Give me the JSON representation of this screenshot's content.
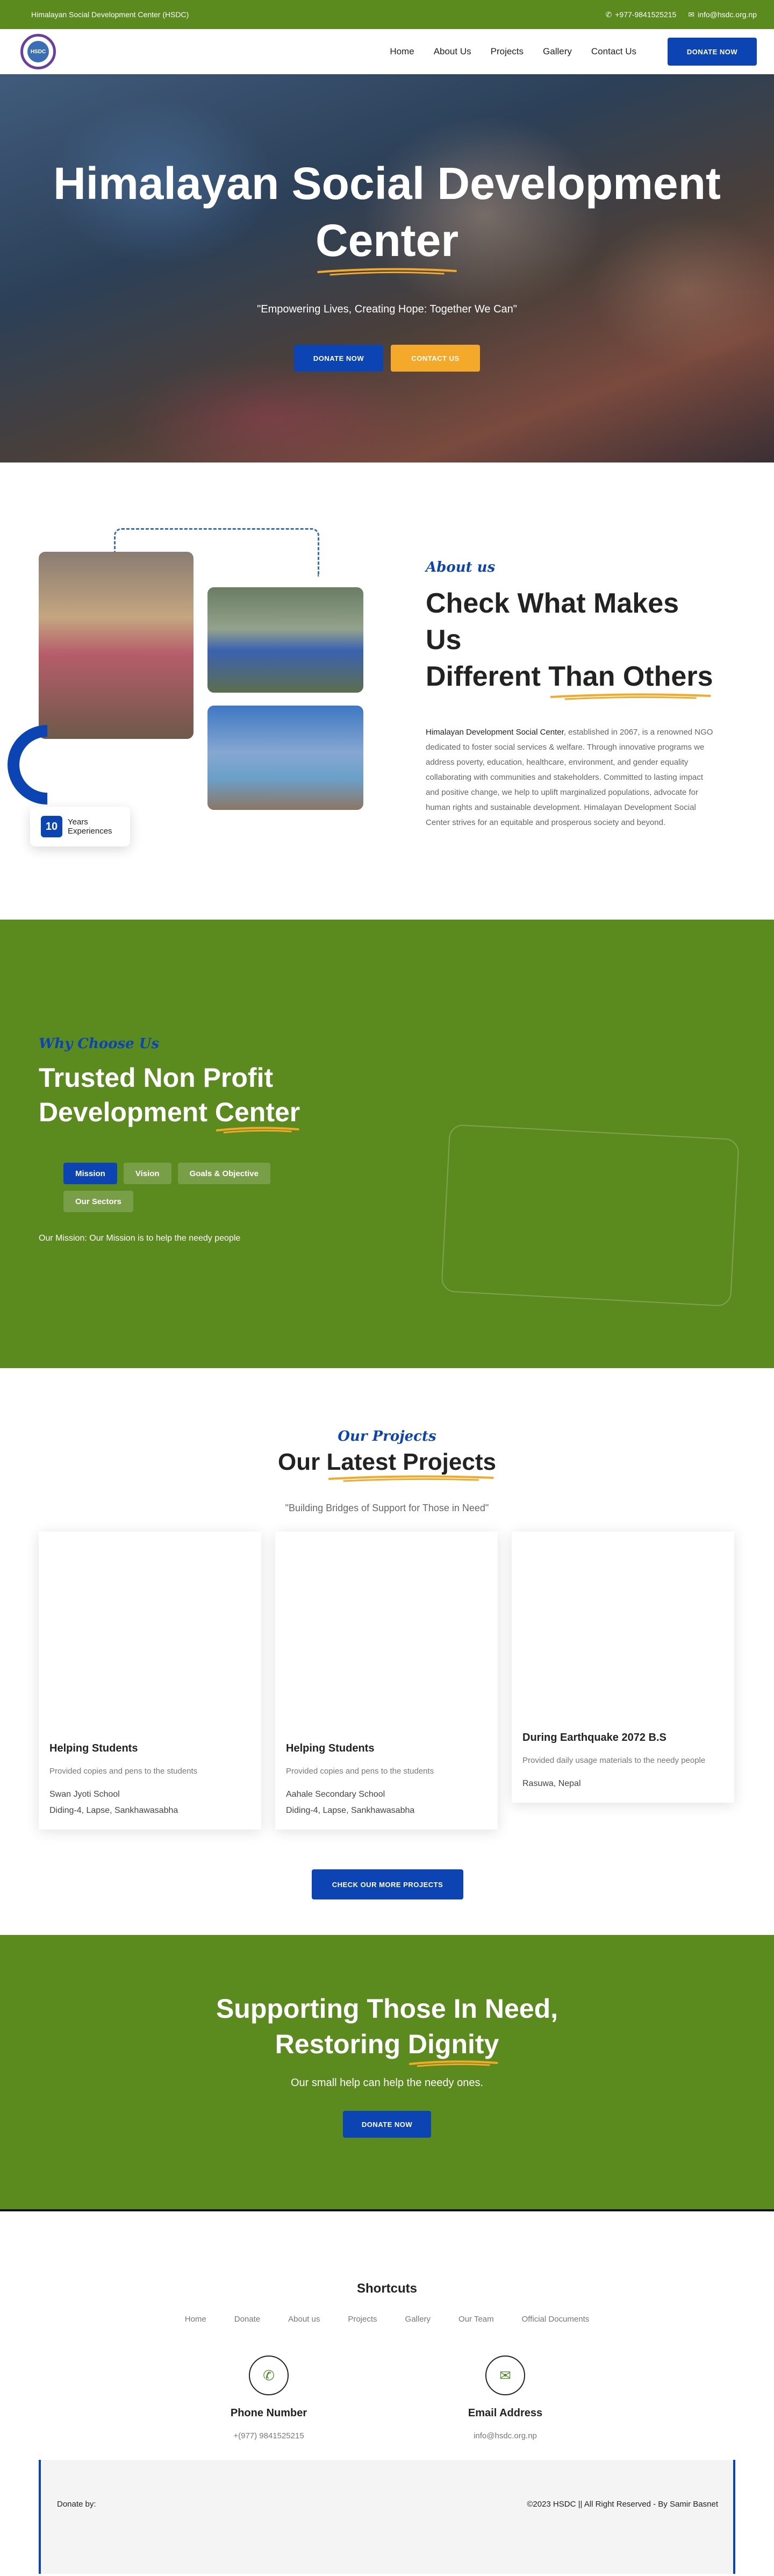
{
  "topbar": {
    "org_name": "Himalayan Social Development Center (HSDC)",
    "phone": "+977-9841525215",
    "email": "info@hsdc.org.np"
  },
  "nav": {
    "logo_text": "HSDC",
    "links": [
      "Home",
      "About Us",
      "Projects",
      "Gallery",
      "Contact Us"
    ],
    "donate": "DONATE NOW"
  },
  "hero": {
    "title_part1": "Himalayan Social Development",
    "title_part2": "Center",
    "tagline": "\"Empowering Lives, Creating Hope: Together We Can\"",
    "donate": "DONATE NOW",
    "contact": "CONTACT US"
  },
  "about": {
    "label": "About us",
    "heading_line1": "Check What Makes Us",
    "heading_line2a": "Different ",
    "heading_line2b": "Than Others",
    "org_name": "Himalayan Development Social Center",
    "description": ", established in 2067, is a renowned NGO dedicated to foster social services & welfare. Through innovative programs we address poverty, education, healthcare, environment, and gender equality collaborating with communities and stakeholders. Committed to lasting impact and positive change, we help to uplift marginalized populations, advocate for human rights and sustainable development. Himalayan Development Social Center strives for an equitable and prosperous society and beyond.",
    "experience_number": "10",
    "experience_line1": "Years",
    "experience_line2": "Experiences"
  },
  "why": {
    "label": "Why Choose Us",
    "heading_line1": "Trusted Non Profit",
    "heading_line2a": "Development ",
    "heading_line2b": "Center",
    "tabs": [
      "Mission",
      "Vision",
      "Goals & Objective",
      "Our Sectors"
    ],
    "active_tab": "Mission",
    "mission_text": "Our Mission: Our Mission is to help the needy people"
  },
  "projects": {
    "label": "Our Projects",
    "heading_a": "Our ",
    "heading_b": "Latest Projects",
    "subtitle": "\"Building Bridges of Support for Those in Need\"",
    "cards": [
      {
        "title": "Helping Students",
        "desc": "Provided copies and pens to the students",
        "school": "Swan Jyoti School",
        "location": "Diding-4, Lapse, Sankhawasabha"
      },
      {
        "title": "Helping Students",
        "desc": "Provided copies and pens to the students",
        "school": "Aahale Secondary School",
        "location": "Diding-4, Lapse, Sankhawasabha"
      },
      {
        "title": "During Earthquake 2072 B.S",
        "desc": "Provided daily usage materials to the needy people",
        "school": "Rasuwa, Nepal",
        "location": ""
      }
    ],
    "more_button": "CHECK OUR MORE PROJECTS"
  },
  "support": {
    "heading_line1": "Supporting Those In Need,",
    "heading_line2a": "Restoring ",
    "heading_line2b": "Dignity",
    "subtitle": "Our small help can help the needy ones.",
    "donate": "DONATE NOW"
  },
  "footer": {
    "shortcuts_title": "Shortcuts",
    "shortcuts": [
      "Home",
      "Donate",
      "About us",
      "Projects",
      "Gallery",
      "Our Team",
      "Official Documents"
    ],
    "phone_title": "Phone Number",
    "phone": "+(977) 9841525215",
    "email_title": "Email Address",
    "email": "info@hsdc.org.np",
    "donate_by": "Donate by:",
    "copyright": "©2023 HSDC || All Right Reserved - By Samir Basnet"
  },
  "colors": {
    "green": "#5b8a1f",
    "blue": "#0c45b3",
    "yellow": "#f4a92a"
  }
}
